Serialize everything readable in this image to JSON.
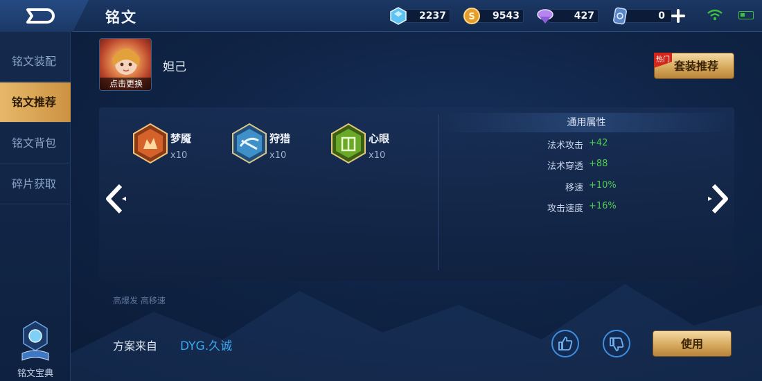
{
  "header": {
    "title": "铭文",
    "resources": [
      {
        "icon": "crystal-icon",
        "value": "2237"
      },
      {
        "icon": "gold-coin-icon",
        "value": "9543"
      },
      {
        "icon": "gem-icon",
        "value": "427"
      },
      {
        "icon": "voucher-icon",
        "value": "0"
      }
    ]
  },
  "sidebar": {
    "items": [
      {
        "label": "铭文装配",
        "active": false
      },
      {
        "label": "铭文推荐",
        "active": true
      },
      {
        "label": "铭文背包",
        "active": false
      },
      {
        "label": "碎片获取",
        "active": false
      }
    ],
    "codex_label": "铭文宝典"
  },
  "hero": {
    "name": "妲己",
    "change_label": "点击更换"
  },
  "suit_button": {
    "label": "套装推荐",
    "tag": "热门"
  },
  "runes": [
    {
      "name": "梦魇",
      "count": "x10",
      "color": "#d4622a"
    },
    {
      "name": "狩猎",
      "count": "x10",
      "color": "#3f8fc9"
    },
    {
      "name": "心眼",
      "count": "x10",
      "color": "#6aa82a"
    }
  ],
  "attributes": {
    "header": "通用属性",
    "items": [
      {
        "label": "法术攻击",
        "value": "+42"
      },
      {
        "label": "法术穿透",
        "value": "+88"
      },
      {
        "label": "移速",
        "value": "+10%"
      },
      {
        "label": "攻击速度",
        "value": "+16%"
      }
    ]
  },
  "note": "高爆发 高移速",
  "source": {
    "label": "方案来自",
    "author": "DYG.久诚"
  },
  "use_button": {
    "label": "使用"
  },
  "colors": {
    "accent_gold": "#d7aa5e",
    "value_green": "#4fce4f",
    "link_blue": "#39a8f0"
  }
}
